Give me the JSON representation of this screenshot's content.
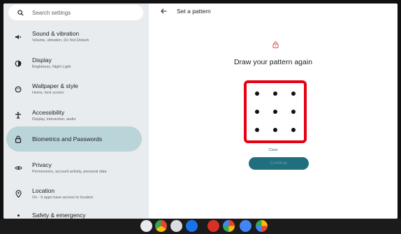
{
  "search": {
    "placeholder": "Search settings"
  },
  "sidebar": {
    "items": [
      {
        "title": "Sound & vibration",
        "subtitle": "Volume, vibration, Do Not Disturb"
      },
      {
        "title": "Display",
        "subtitle": "Brightness, Night Light"
      },
      {
        "title": "Wallpaper & style",
        "subtitle": "Home, lock screen"
      },
      {
        "title": "Accessibility",
        "subtitle": "Display, interaction, audio"
      },
      {
        "title": "Biometrics and Passwords",
        "subtitle": ""
      },
      {
        "title": "Privacy",
        "subtitle": "Permissions, account activity, personal data"
      },
      {
        "title": "Location",
        "subtitle": "On - 6 apps have access to location"
      },
      {
        "title": "Safety & emergency",
        "subtitle": ""
      }
    ]
  },
  "main": {
    "title": "Set a pattern",
    "heading": "Draw your pattern again",
    "clear_label": "Clear",
    "continue_label": "Continue"
  },
  "colors": {
    "accent": "#1f6f7f",
    "highlight": "#e60012",
    "active_item": "#b9d5da"
  },
  "shelf": {
    "apps": [
      "launcher-icon",
      "chrome-icon",
      "camera-icon",
      "settings-icon",
      "app-red-icon",
      "app-pink-icon",
      "app-blue-icon",
      "app-gallery-icon"
    ]
  }
}
